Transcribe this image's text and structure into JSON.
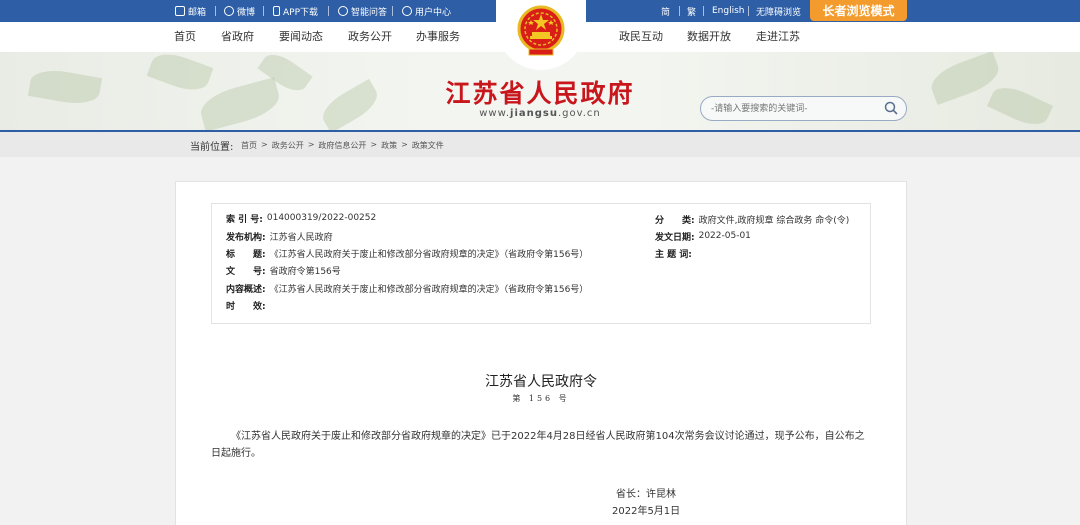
{
  "topbar": {
    "mail": "邮箱",
    "weibo": "微博",
    "app": "APP下载",
    "qa": "智能问答",
    "user_center": "用户中心",
    "simplified": "简",
    "traditional": "繁",
    "english": "English",
    "accessibility": "无障碍浏览",
    "elder_mode": "长者浏览模式"
  },
  "nav": {
    "items_left": [
      "首页",
      "省政府",
      "要闻动态",
      "政务公开",
      "办事服务"
    ],
    "items_right": [
      "政民互动",
      "数据开放",
      "走进江苏"
    ]
  },
  "banner": {
    "title": "江苏省人民政府",
    "url_prefix": "www.",
    "url_bold": "jiangsu",
    "url_suffix": ".gov.cn",
    "search_placeholder": "-请输入要搜索的关键词-"
  },
  "breadcrumb": {
    "label": "当前位置:",
    "items": [
      "首页",
      "政务公开",
      "政府信息公开",
      "政策",
      "政策文件"
    ],
    "separator": ">"
  },
  "meta": {
    "index_label": "索 引 号:",
    "index_value": "014000319/2022-00252",
    "publisher_label": "发布机构:",
    "publisher_value": "江苏省人民政府",
    "title_label": "标　　题:",
    "title_value": "《江苏省人民政府关于废止和修改部分省政府规章的决定》（省政府令第156号）",
    "docno_label": "文　　号:",
    "docno_value": "省政府令第156号",
    "summary_label": "内容概述:",
    "summary_value": "《江苏省人民政府关于废止和修改部分省政府规章的决定》（省政府令第156号）",
    "validity_label": "时　　效:",
    "validity_value": "",
    "category_label": "分　　类:",
    "category_value": "政府文件,政府规章 综合政务 命令(令)",
    "date_label": "发文日期:",
    "date_value": "2022-05-01",
    "subject_label": "主 题 词:",
    "subject_value": ""
  },
  "document": {
    "title": "江苏省人民政府令",
    "number": "第 156 号",
    "body": "《江苏省人民政府关于废止和修改部分省政府规章的决定》已于2022年4月28日经省人民政府第104次常务会议讨论通过，现予公布，自公布之日起施行。",
    "signer": "省长：许昆林",
    "sign_date": "2022年5月1日"
  },
  "colors": {
    "topbar_blue": "#2d5ea6",
    "title_red": "#c8161d",
    "elder_orange": "#f39b2c"
  }
}
